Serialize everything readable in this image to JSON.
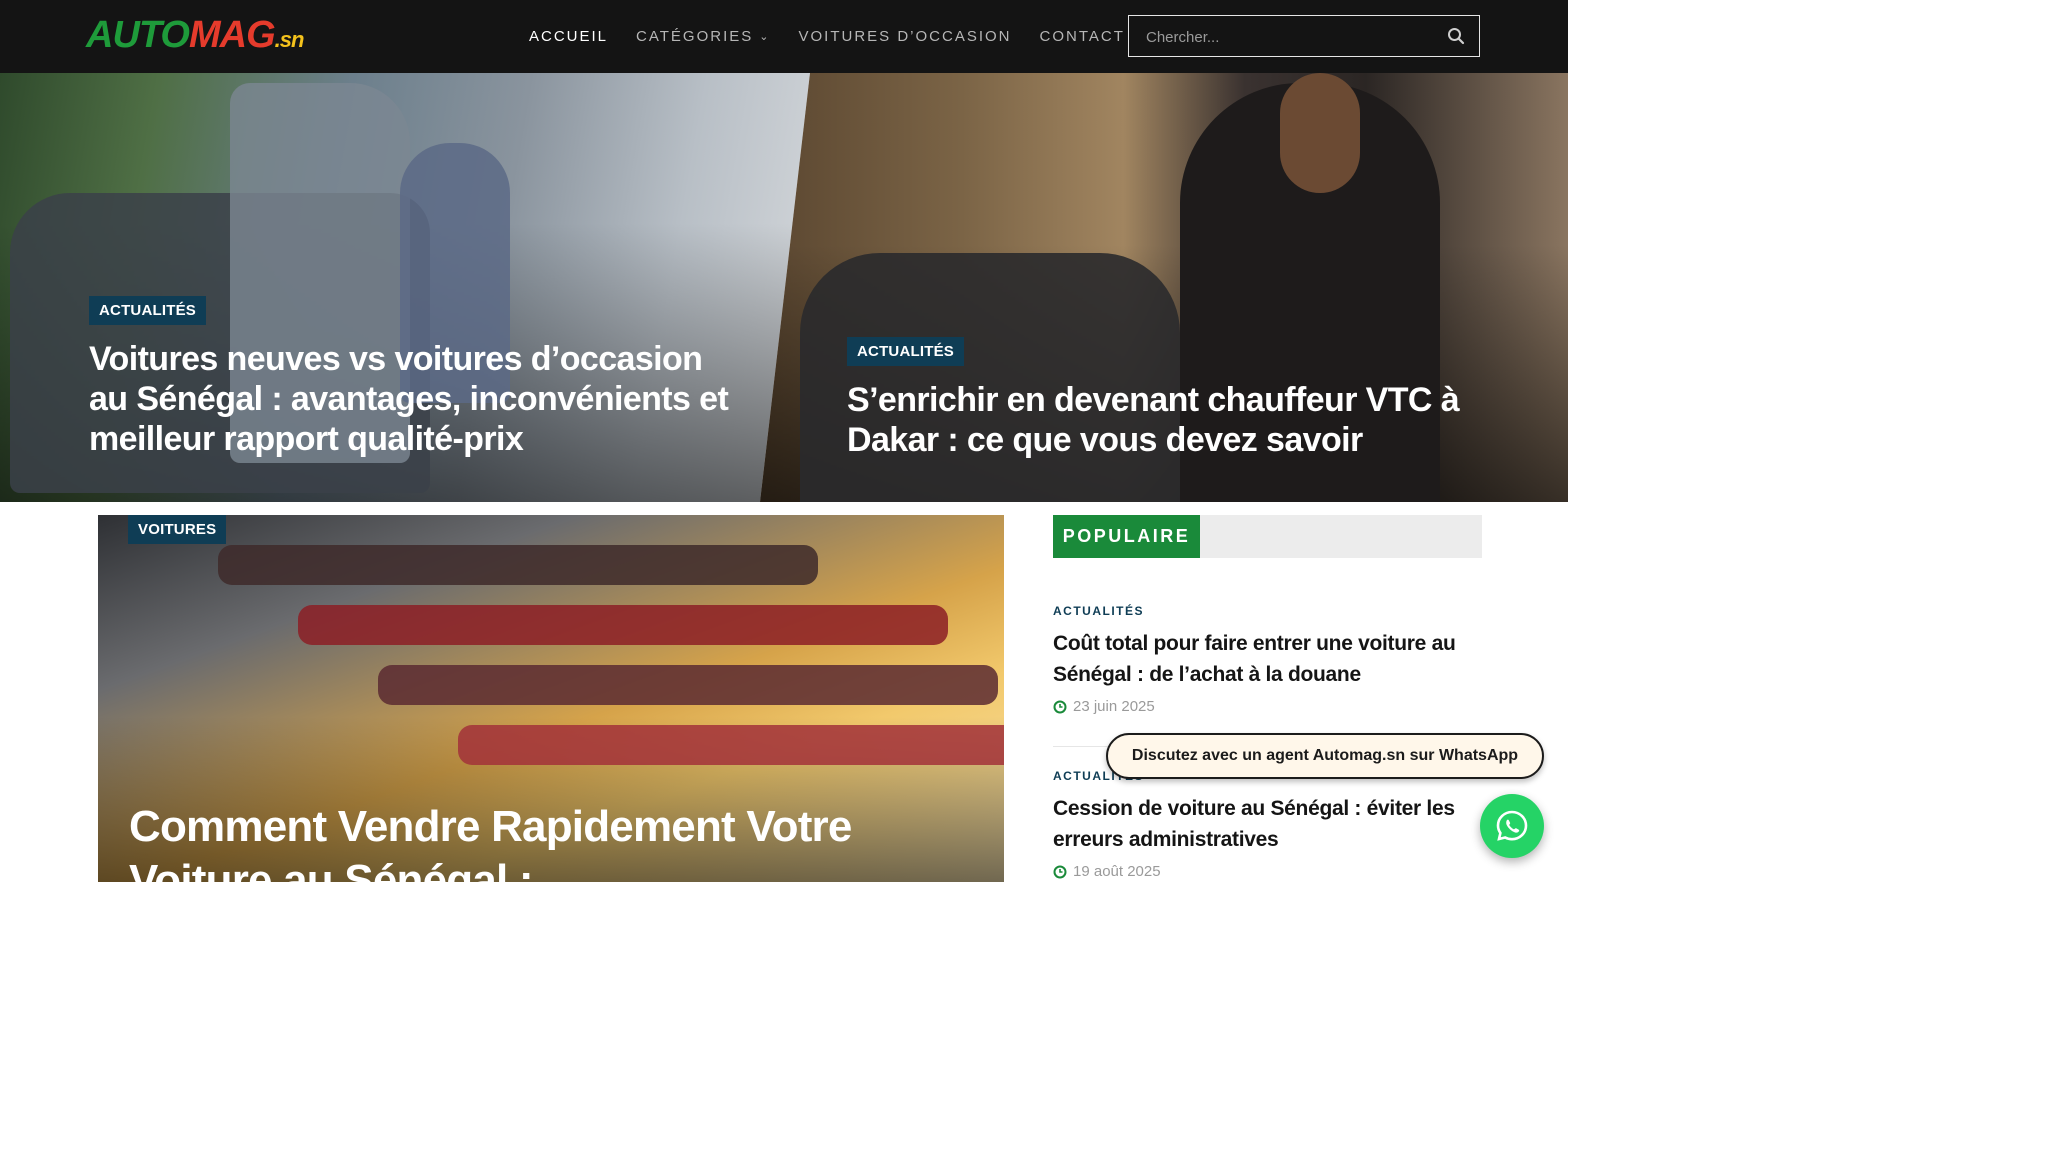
{
  "header": {
    "logo": {
      "part1": "AUTO",
      "part2": "MAG",
      "suffix": ".sn"
    },
    "nav": [
      {
        "label": "ACCUEIL",
        "active": true
      },
      {
        "label": "CATÉGORIES",
        "dropdown": true
      },
      {
        "label": "VOITURES D’OCCASION"
      },
      {
        "label": "CONTACT"
      }
    ],
    "search": {
      "placeholder": "Chercher..."
    }
  },
  "hero": [
    {
      "category": "ACTUALITÉS",
      "title": "Voitures neuves vs voitures d’occasion au Sénégal : avantages, inconvénients et meilleur rapport qualité-prix"
    },
    {
      "category": "ACTUALITÉS",
      "title": "S’enrichir en devenant chauffeur VTC à Dakar : ce que vous devez savoir"
    }
  ],
  "feature": {
    "category": "VOITURES",
    "title": "Comment Vendre Rapidement Votre Voiture au Sénégal :"
  },
  "sidebar": {
    "heading": "POPULAIRE",
    "items": [
      {
        "category": "ACTUALITÉS",
        "title": "Coût total pour faire entrer une voiture au Sénégal : de l’achat à la douane",
        "date": "23 juin 2025"
      },
      {
        "category": "ACTUALITÉS",
        "title": "Cession de voiture au Sénégal : éviter les erreurs administratives",
        "date": "19 août 2025"
      }
    ]
  },
  "whatsapp": {
    "message": "Discutez avec un agent Automag.sn sur WhatsApp"
  },
  "colors": {
    "header_bg": "#141414",
    "accent_green": "#1a8a3a",
    "badge_blue": "#0f3d55",
    "whatsapp": "#25d366"
  }
}
